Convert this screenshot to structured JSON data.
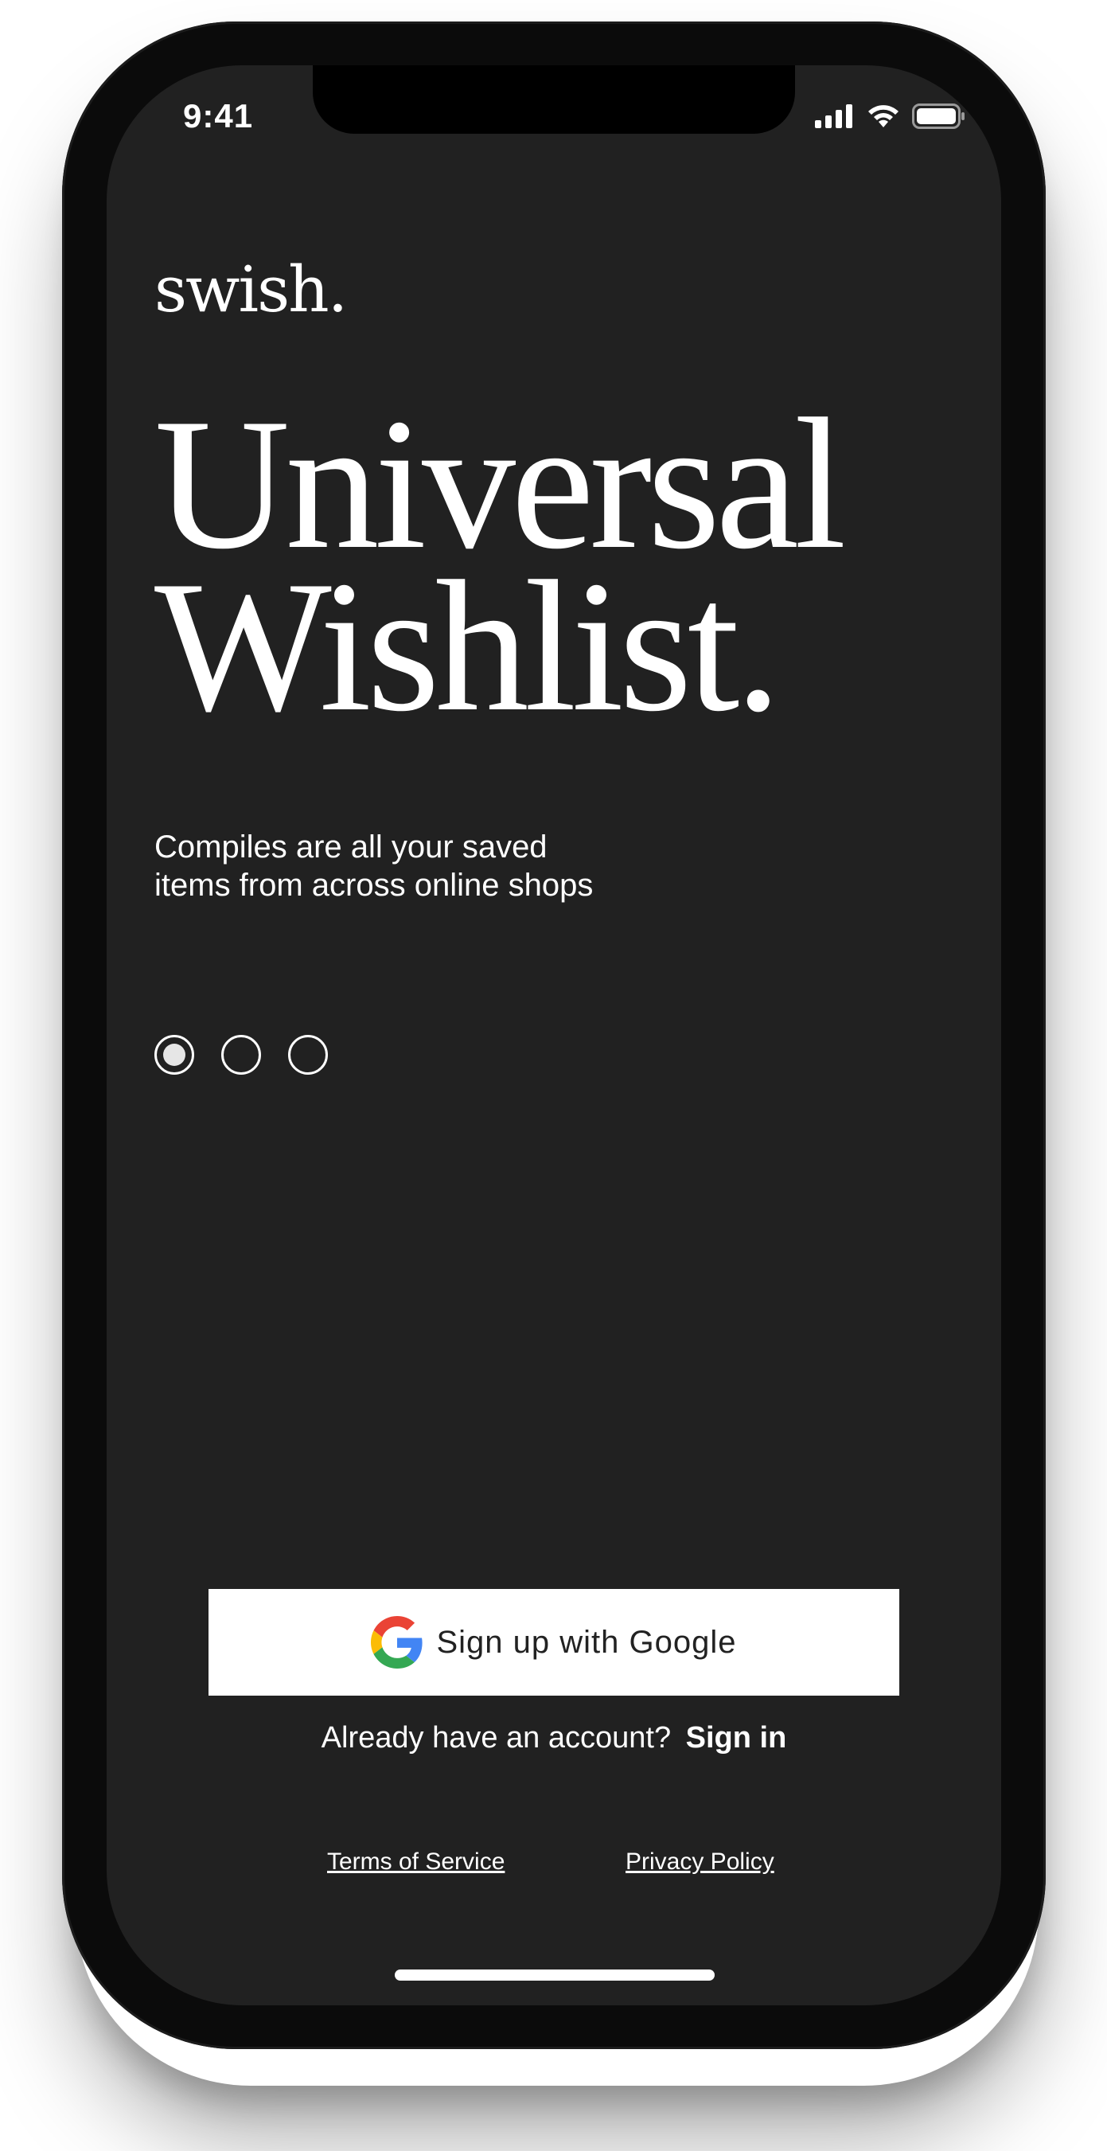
{
  "status_bar": {
    "time": "9:41",
    "icons": [
      "cellular-signal-icon",
      "wifi-icon",
      "battery-icon"
    ]
  },
  "brand": {
    "logo_text": "swish."
  },
  "hero": {
    "headline_line1": "Universal",
    "headline_line2": "Wishlist.",
    "subtitle_line1": "Compiles are all your saved",
    "subtitle_line2": "items from across online shops"
  },
  "pager": {
    "total": 3,
    "active_index": 0
  },
  "actions": {
    "google_button_label": "Sign up with Google",
    "google_icon": "google-logo-icon",
    "account_prompt": "Already have an account?",
    "sign_in_label": "Sign in"
  },
  "footer": {
    "terms_label": "Terms of Service",
    "privacy_label": "Privacy Policy"
  },
  "colors": {
    "screen_background": "#212121",
    "text": "#ffffff",
    "button_background": "#ffffff",
    "button_text": "#222222"
  }
}
